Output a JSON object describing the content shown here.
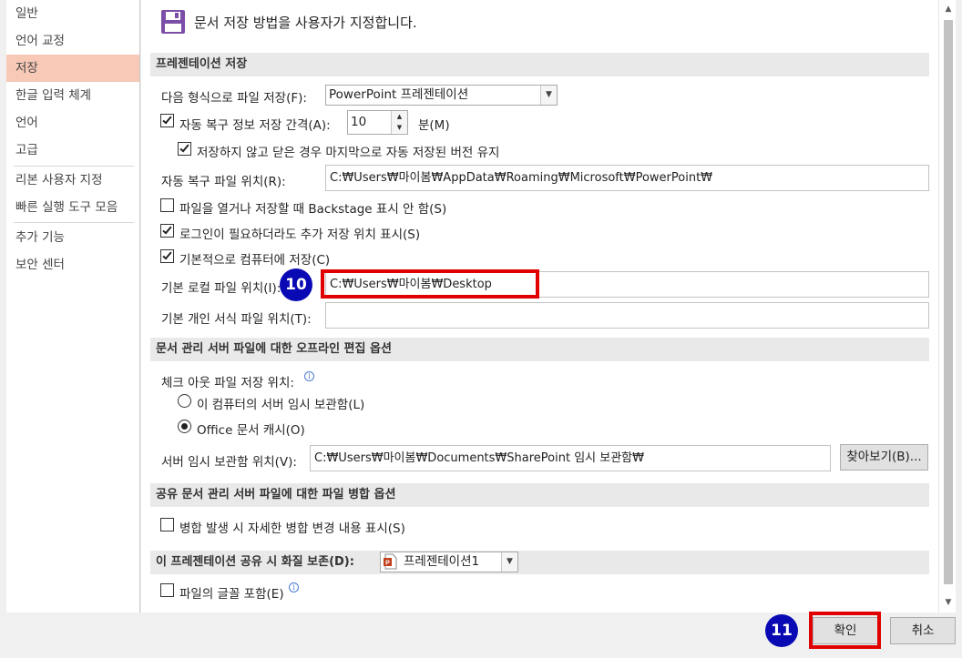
{
  "sidebar": {
    "items": [
      {
        "label": "일반"
      },
      {
        "label": "언어 교정"
      },
      {
        "label": "저장",
        "active": true
      },
      {
        "label": "한글 입력 체계"
      },
      {
        "label": "언어"
      },
      {
        "label": "고급"
      },
      {
        "label": "리본 사용자 지정"
      },
      {
        "label": "빠른 실행 도구 모음"
      },
      {
        "label": "추가 기능"
      },
      {
        "label": "보안 센터"
      }
    ]
  },
  "header": {
    "icon": "save-icon",
    "title": "문서 저장 방법을 사용자가 지정합니다."
  },
  "sections": {
    "presentation_save": "프레젠테이션 저장",
    "offline_editing": "문서 관리 서버 파일에 대한 오프라인 편집 옵션",
    "merge_options": "공유 문서 관리 서버 파일에 대한 파일 병합 옵션",
    "fidelity": "이 프레젠테이션 공유 시 화질 보존(D):"
  },
  "save": {
    "format_label": "다음 형식으로 파일 저장(F):",
    "format_value": "PowerPoint 프레젠테이션",
    "autorecover_label": "자동 복구 정보 저장 간격(A):",
    "autorecover_checked": true,
    "autorecover_minutes": "10",
    "minutes_label": "분(M)",
    "keep_last_label": "저장하지 않고 닫은 경우 마지막으로 자동 저장된 버전 유지",
    "keep_last_checked": true,
    "autorecover_location_label": "자동 복구 파일 위치(R):",
    "autorecover_location_value": "C:₩Users₩마이봄₩AppData₩Roaming₩Microsoft₩PowerPoint₩",
    "no_backstage_label": "파일을 열거나 저장할 때 Backstage 표시 안 함(S)",
    "no_backstage_checked": false,
    "show_additional_label": "로그인이 필요하더라도 추가 저장 위치 표시(S)",
    "show_additional_checked": true,
    "save_to_computer_label": "기본적으로 컴퓨터에 저장(C)",
    "save_to_computer_checked": true,
    "default_local_label": "기본 로컬 파일 위치(I):",
    "default_local_value": "C:₩Users₩마이봄₩Desktop",
    "personal_templates_label": "기본 개인 서식 파일 위치(T):",
    "personal_templates_value": ""
  },
  "offline": {
    "checkout_label": "체크 아웃 파일 저장 위치:",
    "option_server_drafts": "이 컴퓨터의 서버 임시 보관함(L)",
    "option_office_cache": "Office 문서 캐시(O)",
    "selected": "office_cache",
    "server_drafts_label": "서버 임시 보관함 위치(V):",
    "server_drafts_value": "C:₩Users₩마이봄₩Documents₩SharePoint 임시 보관함₩",
    "browse_label": "찾아보기(B)..."
  },
  "merge": {
    "show_details_label": "병합 발생 시 자세한 병합 변경 내용 표시(S)",
    "show_details_checked": false
  },
  "fidelity": {
    "presentation_value": "프레젠테이션1",
    "embed_fonts_label": "파일의 글꼴 포함(E)",
    "embed_fonts_checked": false
  },
  "footer": {
    "ok_label": "확인",
    "cancel_label": "취소"
  },
  "annotations": {
    "step10": "10",
    "step11": "11"
  },
  "colors": {
    "active_nav": "#f8c9b7",
    "highlight": "#e00000",
    "badge": "#0a0ab4",
    "save_icon": "#7b4ea8",
    "ppt_icon": "#c43e1c"
  }
}
